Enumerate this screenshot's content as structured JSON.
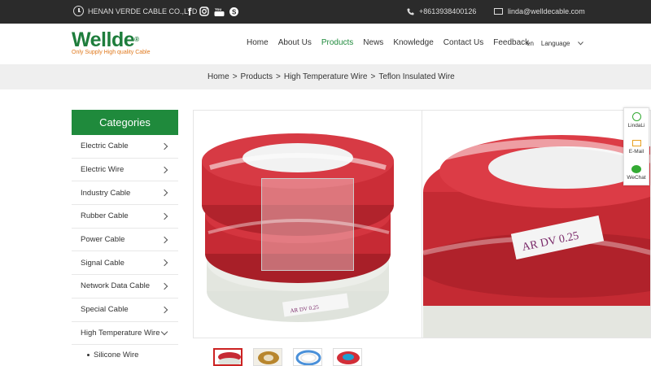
{
  "topbar": {
    "company": "HENAN VERDE CABLE CO.,LTD",
    "phone": "+8613938400126",
    "email": "linda@welldecable.com",
    "social_icons": [
      "facebook-icon",
      "instagram-icon",
      "youtube-icon",
      "skype-icon"
    ]
  },
  "logo": {
    "wordmark": "Wellde",
    "registered": "®",
    "tagline": "Only Supply High quality Cable"
  },
  "nav": {
    "items": [
      "Home",
      "About Us",
      "Products",
      "News",
      "Knowledge",
      "Contact Us",
      "Feedback"
    ],
    "active": "Products"
  },
  "lang": {
    "code": "en",
    "label": "Language"
  },
  "breadcrumb": [
    "Home",
    ">",
    "Products",
    ">",
    "High Temperature Wire",
    ">",
    "Teflon Insulated Wire"
  ],
  "sidebar": {
    "title": "Categories",
    "items": [
      {
        "label": "Electric Cable"
      },
      {
        "label": "Electric Wire"
      },
      {
        "label": "Industry Cable"
      },
      {
        "label": "Rubber Cable"
      },
      {
        "label": "Power Cable"
      },
      {
        "label": "Signal Cable"
      },
      {
        "label": "Network Data Cable"
      },
      {
        "label": "Special Cable"
      },
      {
        "label": "High Temperature Wire"
      }
    ],
    "sub_items": [
      "Silicone Wire"
    ]
  },
  "gallery": {
    "label_text": "AR DV 0.25",
    "thumbnail_count": 4
  },
  "float_panel": {
    "whatsapp": "LindaLi",
    "email": "E-Mail",
    "wechat": "WeChat"
  },
  "colors": {
    "brand_green": "#1f8a3c",
    "topbar_bg": "#2b2b2b",
    "cable_red": "#c8232e",
    "accent_orange": "#e07a1f"
  }
}
